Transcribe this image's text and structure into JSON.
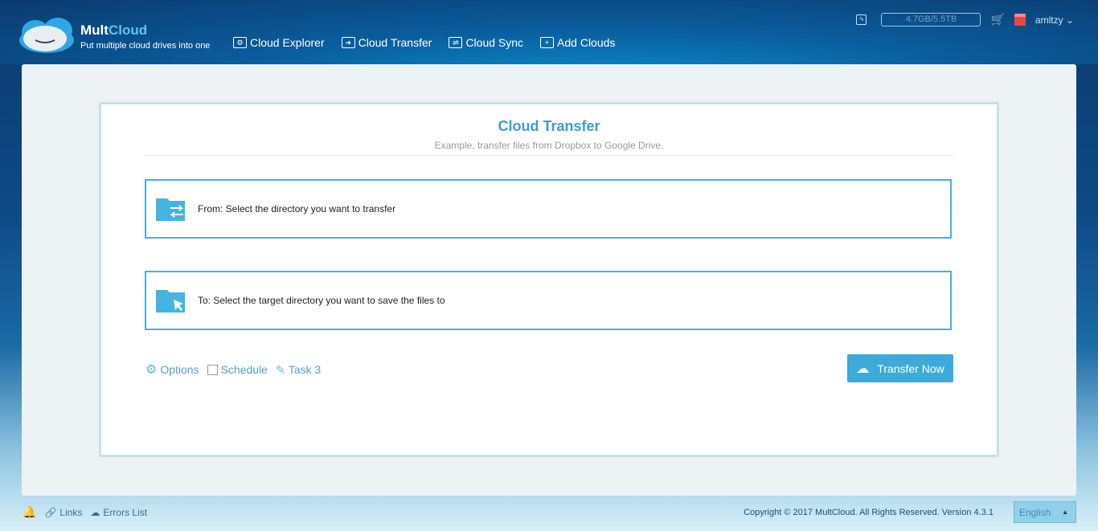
{
  "header": {
    "brand_a": "Mult",
    "brand_b": "Cloud",
    "tagline": "Put multiple cloud drives into one",
    "nav": [
      {
        "label": "Cloud Explorer",
        "icon": "gear-folder-icon"
      },
      {
        "label": "Cloud Transfer",
        "icon": "transfer-icon"
      },
      {
        "label": "Cloud Sync",
        "icon": "sync-icon"
      },
      {
        "label": "Add Clouds",
        "icon": "plus-icon"
      }
    ],
    "storage": "4.7GB/5.5TB",
    "username": "amltzy"
  },
  "panel": {
    "title": "Cloud Transfer",
    "subtitle": "Example, transfer files from Dropbox to Google Drive.",
    "from": "From: Select the directory you want to transfer",
    "to": "To: Select the target directory you want to save the files to",
    "options": "Options",
    "schedule": "Schedule",
    "task": "Task 3",
    "transfer_btn": "Transfer Now"
  },
  "footer": {
    "links": "Links",
    "errors": "Errors List",
    "copyright": "Copyright © 2017 MultCloud. All Rights Reserved. Version 4.3.1",
    "language": "English"
  },
  "colors": {
    "accent": "#3dabd8",
    "border": "#46b3cf"
  }
}
